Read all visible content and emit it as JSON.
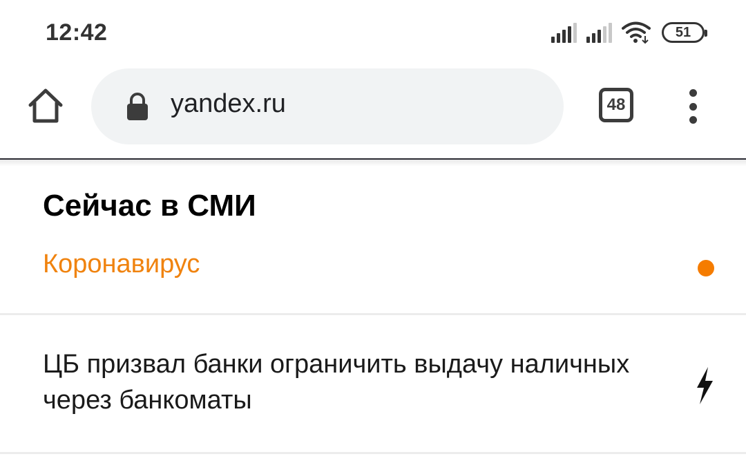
{
  "status_bar": {
    "time": "12:42",
    "battery_level": "51",
    "icons": [
      "signal-icon",
      "signal-icon",
      "wifi-icon",
      "battery-icon"
    ]
  },
  "toolbar": {
    "url": "yandex.ru",
    "tab_count": "48",
    "icons": [
      "home-icon",
      "lock-icon",
      "tabs-icon",
      "more-vert-icon"
    ]
  },
  "content": {
    "section_title": "Сейчас в СМИ",
    "topic": {
      "label": "Коронавирус",
      "indicator_color": "#f57c00"
    },
    "news": [
      {
        "title": "ЦБ призвал банки ограничить выдачу наличных через банкоматы",
        "icon": "lightning-icon"
      }
    ]
  },
  "colors": {
    "accent_orange": "#f0830f",
    "omnibox_bg": "#f1f3f4"
  }
}
